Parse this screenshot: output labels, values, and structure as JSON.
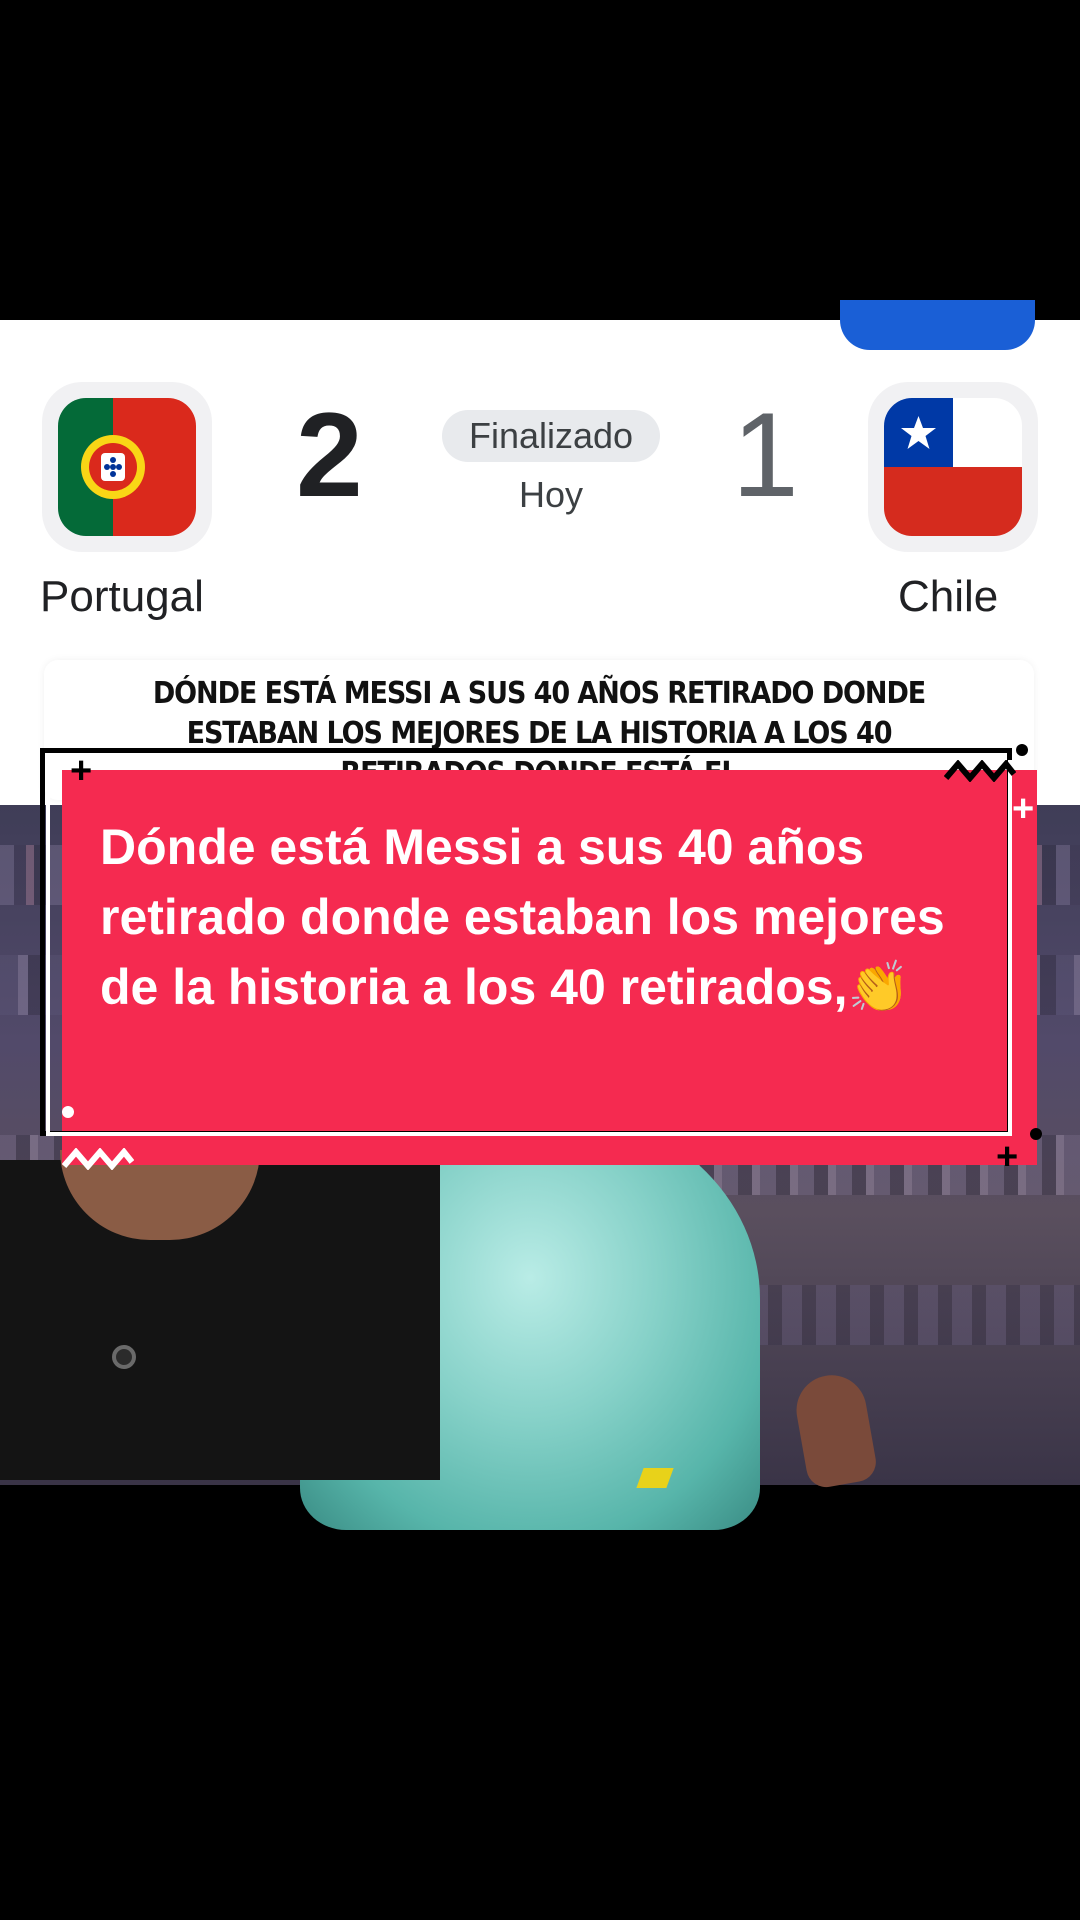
{
  "match": {
    "home_team": "Portugal",
    "away_team": "Chile",
    "home_score": "2",
    "away_score": "1",
    "status": "Finalizado",
    "date": "Hoy"
  },
  "headline": {
    "text": "Dónde está Messi a sus 40 años retirado donde estaban los mejores de la historia a los 40 retirados donde está el"
  },
  "caption": {
    "text": "Dónde está Messi a sus 40 años retirado donde estaban los mejores de la historia a los 40 retirados,👏"
  },
  "colors": {
    "caption_background": "#f52a50",
    "accent_blue": "#1a5fd6",
    "portugal_green": "#046a38",
    "portugal_red": "#da291c",
    "chile_blue": "#0039a6",
    "chile_red": "#d52b1e"
  },
  "icons": {
    "home_flag": "portugal-flag-icon",
    "away_flag": "chile-flag-icon",
    "emoji": "clapping-hands-icon"
  }
}
